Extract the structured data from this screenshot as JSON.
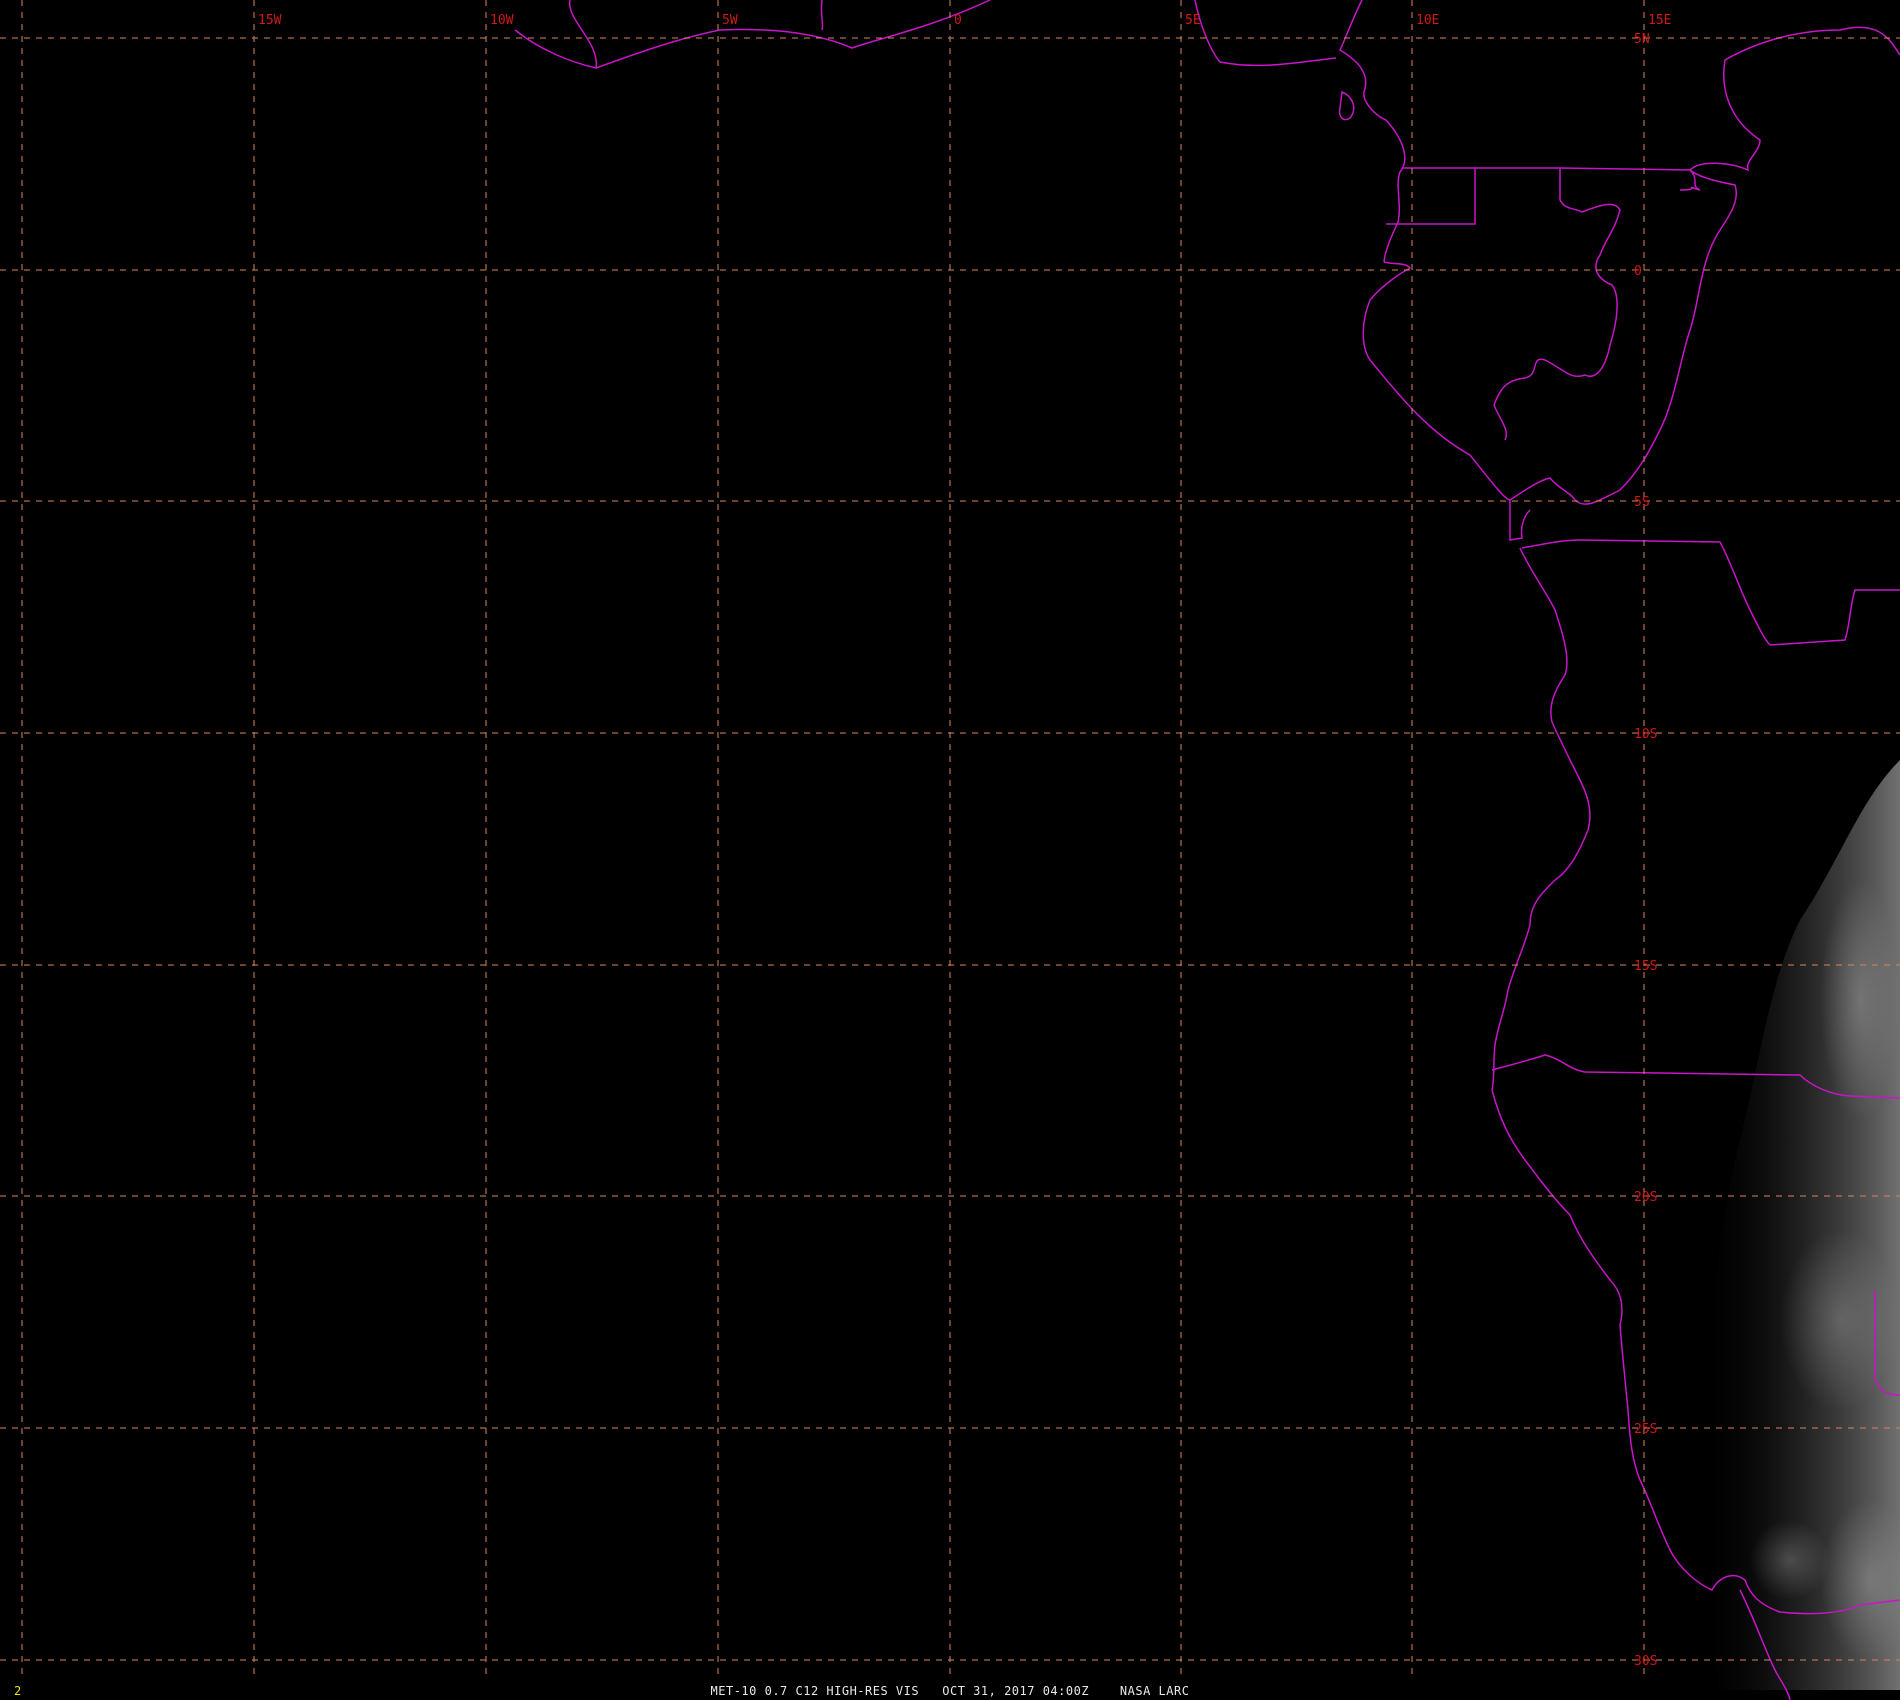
{
  "satellite_view": {
    "caption": "MET-10 0.7 C12 HIGH-RES VIS   OCT 31, 2017 04:00Z    NASA LARC",
    "frame_number": "2"
  },
  "grid": {
    "lon_labels": [
      "15W",
      "10W",
      "5W",
      "0",
      "5E",
      "10E",
      "15E"
    ],
    "lat_labels": [
      "5N",
      "0",
      "5S",
      "10S",
      "15S",
      "20S",
      "25S",
      "30S"
    ]
  },
  "colors": {
    "background": "#000000",
    "grid_line": "#d4875a",
    "grid_label": "#d01818",
    "boundaries": "#c815c8",
    "caption_text": "#e8e8e8",
    "frame_number": "#e6e600"
  }
}
